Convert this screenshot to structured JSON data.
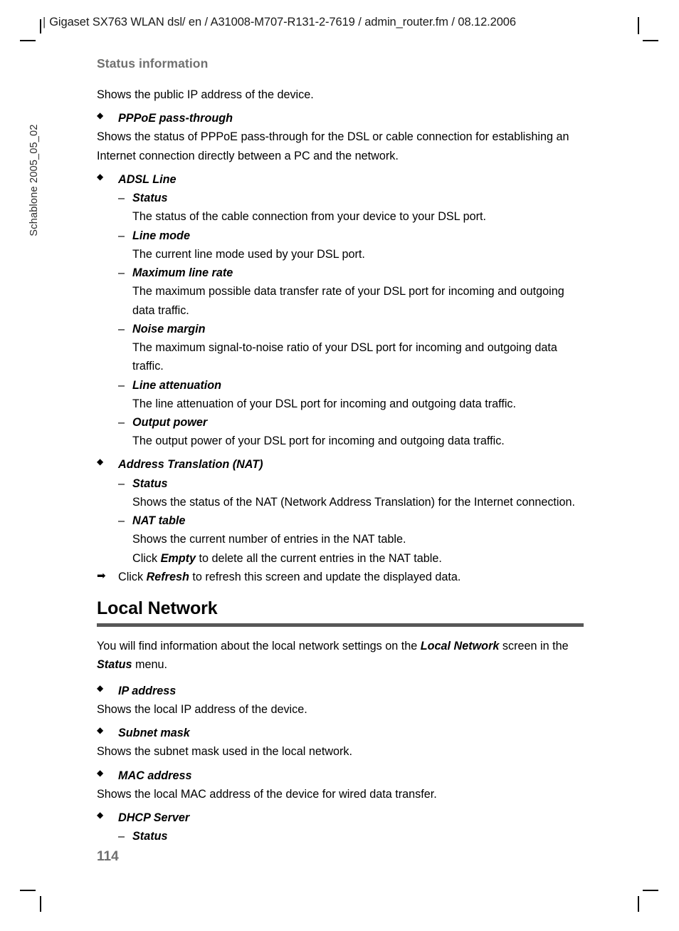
{
  "page": {
    "header_line": "Gigaset SX763 WLAN dsl/ en / A31008-M707-R131-2-7619 / admin_router.fm / 08.12.2006",
    "header_bar": "|",
    "side_label": "Schablone 2005_05_02",
    "running_head": "Status information",
    "folio": "114",
    "rule_color": "#575757",
    "running_head_color": "#70706f",
    "folio_color": "#6f6f6f"
  },
  "glyphs": {
    "diamond": "◆",
    "dash": "–",
    "arrow": "➡"
  },
  "body": {
    "intro_line": "Shows the public IP address of the device.",
    "pppoe": {
      "title": "PPPoE pass-through",
      "text": "Shows the status of PPPoE pass-through for the DSL or cable connection for establishing an Internet connection directly between a PC and the network."
    },
    "adsl": {
      "title": "ADSL Line",
      "items": [
        {
          "label": "Status",
          "text": "The status of the cable connection from your device to your DSL port."
        },
        {
          "label": "Line mode",
          "text": "The current line mode used by your DSL port."
        },
        {
          "label": "Maximum line rate",
          "text": "The maximum possible data transfer rate of your DSL port for incoming and outgoing data traffic."
        },
        {
          "label": "Noise margin",
          "text": "The maximum signal-to-noise ratio of your DSL port for incoming and outgoing data traffic."
        },
        {
          "label": "Line attenuation",
          "text": "The line attenuation of your DSL port for incoming and outgoing data traffic."
        },
        {
          "label": "Output power",
          "text": "The output power of your DSL port for incoming and outgoing data traffic."
        }
      ]
    },
    "nat": {
      "title": "Address Translation (NAT)",
      "status_label": "Status",
      "status_text": "Shows the status of the NAT (Network Address Translation) for the Internet connection.",
      "table_label": "NAT table",
      "table_text": "Shows the current number of entries in the NAT table.",
      "empty_prefix": "Click ",
      "empty_keyword": "Empty",
      "empty_suffix": " to delete all the current entries in the NAT table."
    },
    "refresh": {
      "prefix": "Click ",
      "keyword": "Refresh",
      "suffix": " to refresh this screen and update the displayed data."
    }
  },
  "local_network": {
    "heading": "Local Network",
    "intro_prefix": "You will find information about the local network settings on the ",
    "intro_keyword1": "Local Network",
    "intro_middle": " screen in the ",
    "intro_keyword2": "Status",
    "intro_suffix": " menu.",
    "items": [
      {
        "label": "IP address",
        "text": "Shows the local IP address of the device."
      },
      {
        "label": "Subnet mask",
        "text": "Shows the subnet mask used in the local network."
      },
      {
        "label": "MAC address",
        "text": "Shows the local MAC address of the device for wired data transfer."
      }
    ],
    "dhcp": {
      "title": "DHCP Server",
      "status_label": "Status"
    }
  }
}
